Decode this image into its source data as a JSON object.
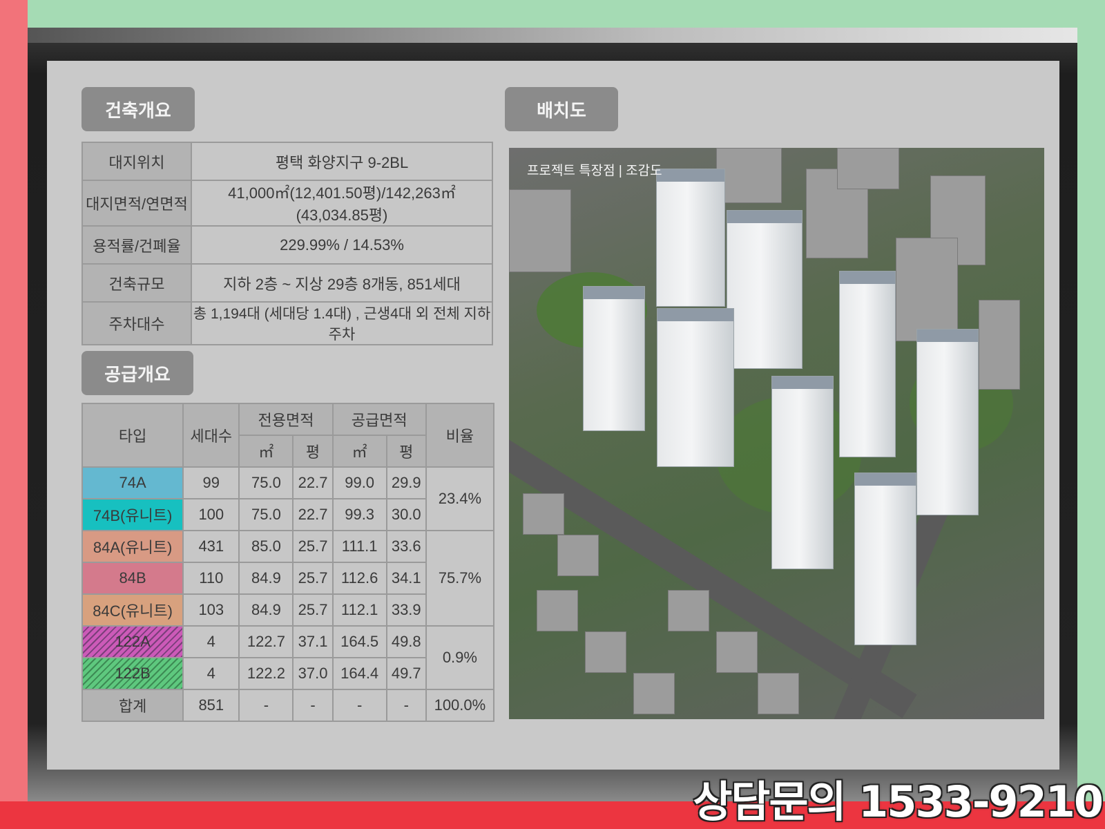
{
  "overview": {
    "tag": "건축개요",
    "rows": [
      {
        "label": "대지위치",
        "value": "평택 화양지구 9-2BL"
      },
      {
        "label": "대지면적/연면적",
        "value": "41,000㎡(12,401.50평)/142,263㎡(43,034.85평)"
      },
      {
        "label": "용적률/건폐율",
        "value": "229.99% / 14.53%"
      },
      {
        "label": "건축규모",
        "value": "지하 2층 ~ 지상 29층 8개동, 851세대"
      },
      {
        "label": "주차대수",
        "value": "총 1,194대 (세대당 1.4대) , 근생4대 외 전체 지하주차"
      }
    ]
  },
  "supply": {
    "tag": "공급개요",
    "headers": {
      "type": "타입",
      "households": "세대수",
      "exclusive_area": "전용면적",
      "supply_area": "공급면적",
      "ratio": "비율",
      "sqm": "㎡",
      "pyeong": "평"
    },
    "rows": [
      {
        "type": "74A",
        "households": "99",
        "ex_sqm": "75.0",
        "ex_py": "22.7",
        "sup_sqm": "99.0",
        "sup_py": "29.9",
        "color": "#64b8d0"
      },
      {
        "type": "74B(유니트)",
        "households": "100",
        "ex_sqm": "75.0",
        "ex_py": "22.7",
        "sup_sqm": "99.3",
        "sup_py": "30.0",
        "color": "#17c0c0"
      },
      {
        "type": "84A(유니트)",
        "households": "431",
        "ex_sqm": "85.0",
        "ex_py": "25.7",
        "sup_sqm": "111.1",
        "sup_py": "33.6",
        "color": "#d89a84"
      },
      {
        "type": "84B",
        "households": "110",
        "ex_sqm": "84.9",
        "ex_py": "25.7",
        "sup_sqm": "112.6",
        "sup_py": "34.1",
        "color": "#d47a8c"
      },
      {
        "type": "84C(유니트)",
        "households": "103",
        "ex_sqm": "84.9",
        "ex_py": "25.7",
        "sup_sqm": "112.1",
        "sup_py": "33.9",
        "color": "#d8a17e"
      },
      {
        "type": "122A",
        "households": "4",
        "ex_sqm": "122.7",
        "ex_py": "37.1",
        "sup_sqm": "164.5",
        "sup_py": "49.8",
        "color": "#cc5ab8"
      },
      {
        "type": "122B",
        "households": "4",
        "ex_sqm": "122.2",
        "ex_py": "37.0",
        "sup_sqm": "164.4",
        "sup_py": "49.7",
        "color": "#5ec87e"
      }
    ],
    "ratios": [
      "23.4%",
      "75.7%",
      "0.9%"
    ],
    "total": {
      "label": "합계",
      "households": "851",
      "ex_sqm": "-",
      "ex_py": "-",
      "sup_sqm": "-",
      "sup_py": "-",
      "ratio": "100.0%"
    }
  },
  "siteplan": {
    "tag": "배치도",
    "caption": "프로젝트 특장점 | 조감도"
  },
  "contact": "상담문의 1533-9210"
}
